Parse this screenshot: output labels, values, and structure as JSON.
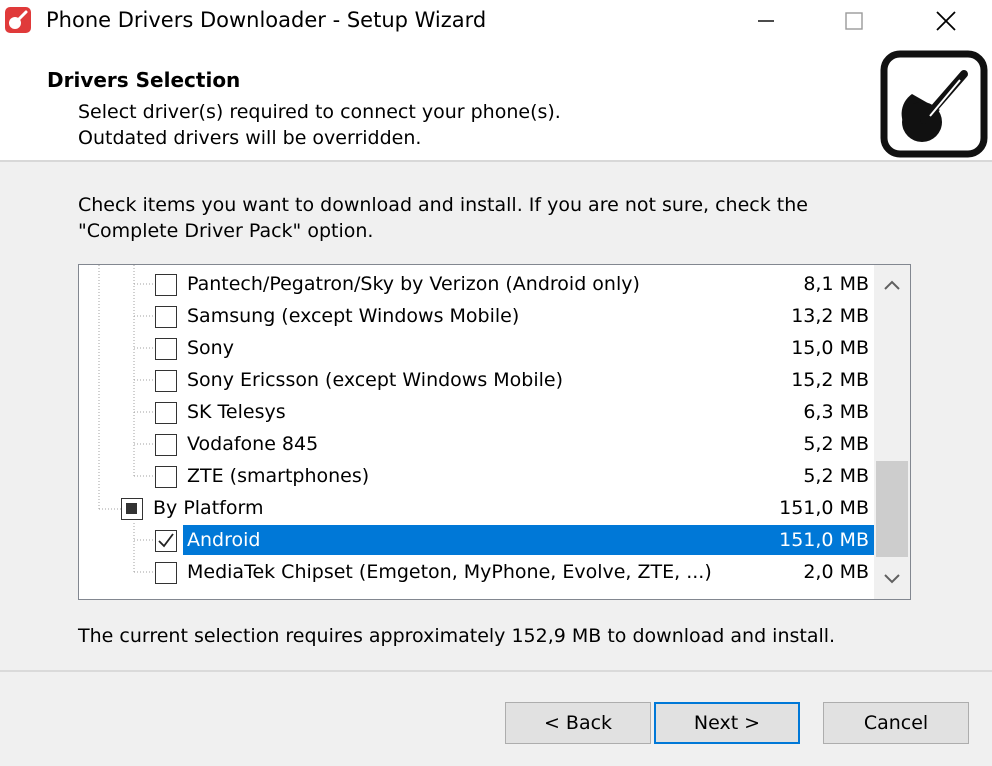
{
  "window": {
    "title": "Phone Drivers Downloader - Setup Wizard"
  },
  "header": {
    "title": "Drivers Selection",
    "subtitle_line1": "Select driver(s) required to connect your phone(s).",
    "subtitle_line2": "Outdated drivers will be overridden."
  },
  "instructions": "Check items you want to download and install. If you are not sure, check the \"Complete Driver Pack\" option.",
  "tree": {
    "items": [
      {
        "label": "Pantech/Pegatron/Sky by Verizon (Android only)",
        "size": "8,1 MB",
        "checked": false
      },
      {
        "label": "Samsung (except Windows Mobile)",
        "size": "13,2 MB",
        "checked": false
      },
      {
        "label": "Sony",
        "size": "15,0 MB",
        "checked": false
      },
      {
        "label": "Sony Ericsson (except Windows Mobile)",
        "size": "15,2 MB",
        "checked": false
      },
      {
        "label": "SK Telesys",
        "size": "6,3 MB",
        "checked": false
      },
      {
        "label": "Vodafone 845",
        "size": "5,2 MB",
        "checked": false
      },
      {
        "label": "ZTE (smartphones)",
        "size": "5,2 MB",
        "checked": false
      },
      {
        "label": "By Platform",
        "size": "151,0 MB",
        "checked": "partial"
      },
      {
        "label": "Android",
        "size": "151,0 MB",
        "checked": true
      },
      {
        "label": "MediaTek Chipset (Emgeton, MyPhone, Evolve, ZTE, ...)",
        "size": "2,0 MB",
        "checked": false
      }
    ]
  },
  "summary": "The current selection requires approximately 152,9 MB to download and install.",
  "buttons": {
    "back": "< Back",
    "next": "Next >",
    "cancel": "Cancel"
  },
  "colors": {
    "selection": "#0078d7",
    "brand_red": "#e03a3a"
  }
}
